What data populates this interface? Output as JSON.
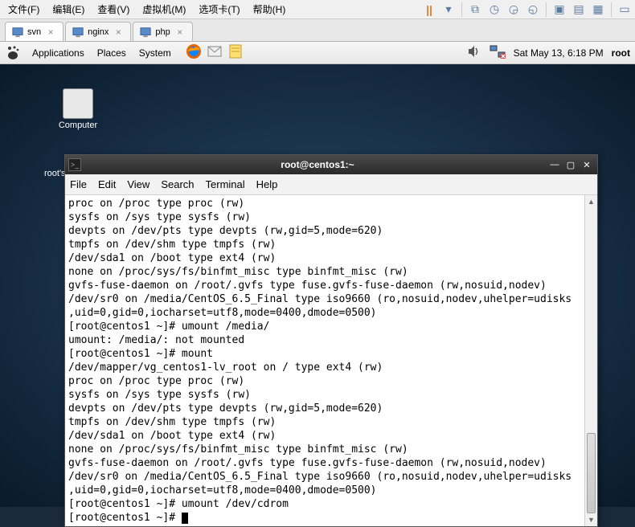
{
  "host_menu": {
    "items": [
      "文件(F)",
      "编辑(E)",
      "查看(V)",
      "虚拟机(M)",
      "选项卡(T)",
      "帮助(H)"
    ]
  },
  "tabs": [
    {
      "label": "svn",
      "active": true
    },
    {
      "label": "nginx",
      "active": false
    },
    {
      "label": "php",
      "active": false
    }
  ],
  "gnome": {
    "menus": [
      "Applications",
      "Places",
      "System"
    ],
    "clock": "Sat May 13,  6:18 PM",
    "user": "root"
  },
  "desktop": {
    "icon1_label": "Computer",
    "icon2_label": "root's Home"
  },
  "terminal": {
    "title": "root@centos1:~",
    "menus": [
      "File",
      "Edit",
      "View",
      "Search",
      "Terminal",
      "Help"
    ],
    "lines": [
      "proc on /proc type proc (rw)",
      "sysfs on /sys type sysfs (rw)",
      "devpts on /dev/pts type devpts (rw,gid=5,mode=620)",
      "tmpfs on /dev/shm type tmpfs (rw)",
      "/dev/sda1 on /boot type ext4 (rw)",
      "none on /proc/sys/fs/binfmt_misc type binfmt_misc (rw)",
      "gvfs-fuse-daemon on /root/.gvfs type fuse.gvfs-fuse-daemon (rw,nosuid,nodev)",
      "/dev/sr0 on /media/CentOS_6.5_Final type iso9660 (ro,nosuid,nodev,uhelper=udisks",
      ",uid=0,gid=0,iocharset=utf8,mode=0400,dmode=0500)",
      "[root@centos1 ~]# umount /media/",
      "umount: /media/: not mounted",
      "[root@centos1 ~]# mount",
      "/dev/mapper/vg_centos1-lv_root on / type ext4 (rw)",
      "proc on /proc type proc (rw)",
      "sysfs on /sys type sysfs (rw)",
      "devpts on /dev/pts type devpts (rw,gid=5,mode=620)",
      "tmpfs on /dev/shm type tmpfs (rw)",
      "/dev/sda1 on /boot type ext4 (rw)",
      "none on /proc/sys/fs/binfmt_misc type binfmt_misc (rw)",
      "gvfs-fuse-daemon on /root/.gvfs type fuse.gvfs-fuse-daemon (rw,nosuid,nodev)",
      "/dev/sr0 on /media/CentOS_6.5_Final type iso9660 (ro,nosuid,nodev,uhelper=udisks",
      ",uid=0,gid=0,iocharset=utf8,mode=0400,dmode=0500)",
      "[root@centos1 ~]# umount /dev/cdrom",
      "[root@centos1 ~]# "
    ]
  }
}
